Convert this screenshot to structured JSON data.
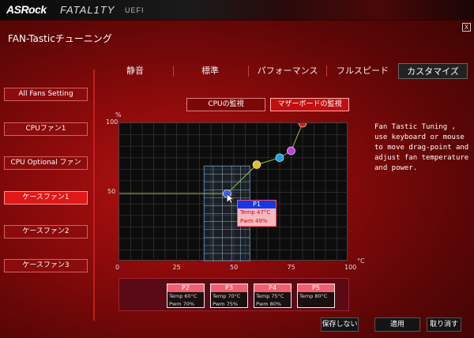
{
  "brand": {
    "name": "ASRock",
    "series": "FATAL1TY",
    "firmware": "UEFI"
  },
  "window": {
    "title": "FAN-Tasticチューニング",
    "close": "X"
  },
  "tabs": [
    {
      "label": "静音"
    },
    {
      "label": "標準"
    },
    {
      "label": "パフォーマンス"
    },
    {
      "label": "フルスピード"
    },
    {
      "label": "カスタマイズ",
      "active": true
    }
  ],
  "sidebar": [
    {
      "label": "All Fans Setting"
    },
    {
      "label": "CPUファン1"
    },
    {
      "label": "CPU Optional ファン"
    },
    {
      "label": "ケースファン1",
      "active": true
    },
    {
      "label": "ケースファン2"
    },
    {
      "label": "ケースファン3"
    }
  ],
  "monitor": {
    "cpu": "CPUの監視",
    "mb": "マザーボードの監視"
  },
  "chart_data": {
    "type": "line",
    "x_unit": "°C",
    "y_unit": "%",
    "x_ticks": [
      "0",
      "25",
      "50",
      "75",
      "100"
    ],
    "y_ticks": [
      "50",
      "100"
    ],
    "xlim": [
      0,
      100
    ],
    "ylim": [
      0,
      100
    ],
    "grid": true,
    "points": [
      {
        "name": "P1",
        "temp": 47,
        "pwm": 49,
        "color": "#4060e0"
      },
      {
        "name": "P2",
        "temp": 60,
        "pwm": 70,
        "color": "#e0c020"
      },
      {
        "name": "P3",
        "temp": 70,
        "pwm": 75,
        "color": "#20a0e0"
      },
      {
        "name": "P4",
        "temp": 75,
        "pwm": 80,
        "color": "#c040e0"
      },
      {
        "name": "P5",
        "temp": 80,
        "pwm": 100,
        "color": "#e01818"
      }
    ]
  },
  "tooltip": {
    "title": "P1",
    "temp": "Temp 47°C",
    "pwm": "Pwm  49%"
  },
  "help_text": "Fan Tastic Tuning , use keyboard or mouse to move drag-point and adjust fan temperature and power.",
  "point_cards": [
    {
      "title": "P2",
      "temp": "Temp 60°C",
      "pwm": "Pwm  70%"
    },
    {
      "title": "P3",
      "temp": "Temp 70°C",
      "pwm": "Pwm  75%"
    },
    {
      "title": "P4",
      "temp": "Temp 75°C",
      "pwm": "Pwm  80%"
    },
    {
      "title": "P5",
      "temp": "Temp 80°C",
      "pwm": ""
    }
  ],
  "buttons": {
    "discard": "保存しない",
    "apply": "適用",
    "cancel": "取り消す"
  }
}
